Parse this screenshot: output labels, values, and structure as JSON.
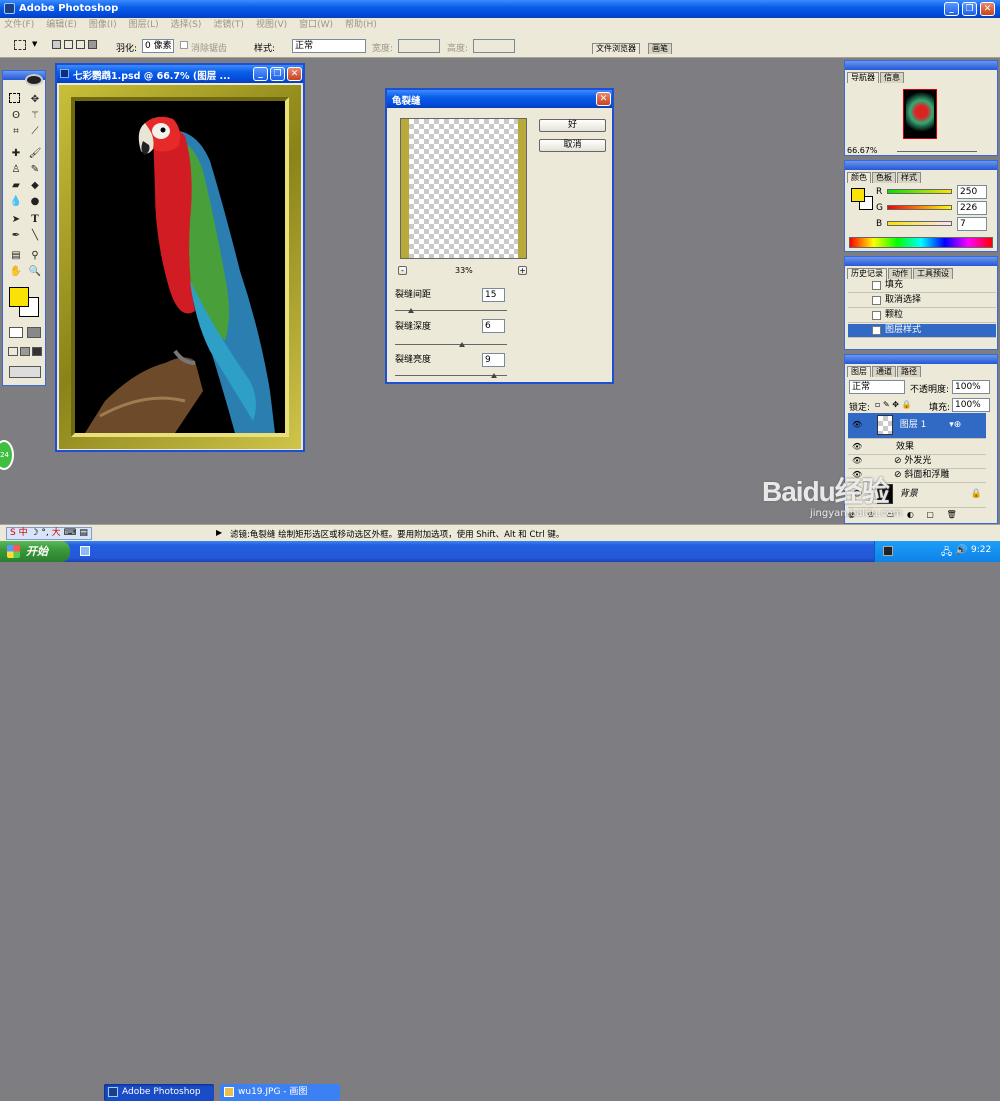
{
  "app": {
    "title": "Adobe Photoshop"
  },
  "menu": [
    "文件(F)",
    "编辑(E)",
    "图像(I)",
    "图层(L)",
    "选择(S)",
    "滤镜(T)",
    "视图(V)",
    "窗口(W)",
    "帮助(H)"
  ],
  "options": {
    "feather_label": "羽化:",
    "feather_value": "0 像素",
    "antialias": "消除锯齿",
    "style_label": "样式:",
    "style_value": "正常",
    "width_label": "宽度:",
    "height_label": "高度:",
    "tab_browser": "文件浏览器",
    "tab_brush": "画笔"
  },
  "doc": {
    "title": "七彩鹦鹉1.psd @ 66.7% (图层 ..."
  },
  "filter": {
    "title": "龟裂缝",
    "ok": "好",
    "cancel": "取消",
    "zoom": "33%",
    "minus": "-",
    "plus": "+",
    "p1_label": "裂缝间距",
    "p1_value": "15",
    "p1_level": 0.14,
    "p2_label": "裂缝深度",
    "p2_value": "6",
    "p2_level": 0.6,
    "p3_label": "裂缝亮度",
    "p3_value": "9",
    "p3_level": 0.88
  },
  "navigator": {
    "tab1": "导航器",
    "tab2": "信息",
    "zoom": "66.67%"
  },
  "color": {
    "tab1": "颜色",
    "tab2": "色板",
    "tab3": "样式",
    "r": "250",
    "g": "226",
    "b": "7",
    "r_label": "R",
    "g_label": "G",
    "b_label": "B",
    "fg": "#fae207"
  },
  "history": {
    "tab1": "历史记录",
    "tab2": "动作",
    "tab3": "工具预设",
    "items": [
      "填充",
      "取消选择",
      "颗粒",
      "图层样式"
    ]
  },
  "layers": {
    "tab1": "图层",
    "tab2": "通道",
    "tab3": "路径",
    "blend": "正常",
    "opacity_label": "不透明度:",
    "opacity": "100%",
    "lock_label": "锁定:",
    "fill_label": "填充:",
    "fill": "100%",
    "layer1": "图层 1",
    "effects": "效果",
    "fx1": "外发光",
    "fx2": "斜面和浮雕",
    "bg": "背景"
  },
  "status": {
    "message": "滤镜:龟裂缝  绘制矩形选区或移动选区外框。要用附加选项，使用 Shift、Alt 和 Ctrl 键。",
    "ime": "中",
    "ime_extra": "大"
  },
  "taskbar": {
    "start": "开始",
    "task1": "Adobe Photoshop",
    "task2": "wu19.JPG - 画图",
    "time": "9:22",
    "badge": "24"
  },
  "watermark": {
    "text": "Baidu经验",
    "url": "jingyan.baidu.com"
  }
}
